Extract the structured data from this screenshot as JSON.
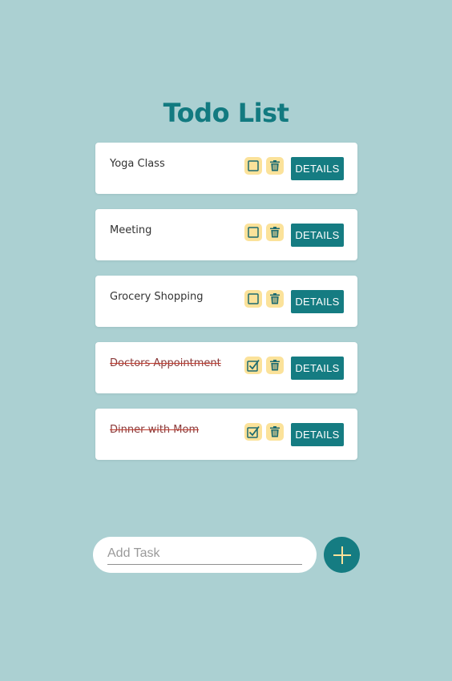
{
  "app": {
    "title": "Todo List"
  },
  "tasks": [
    {
      "label": "Yoga Class",
      "done": false,
      "details_label": "DETAILS"
    },
    {
      "label": "Meeting",
      "done": false,
      "details_label": "DETAILS"
    },
    {
      "label": "Grocery Shopping",
      "done": false,
      "details_label": "DETAILS"
    },
    {
      "label": "Doctors Appointment",
      "done": true,
      "details_label": "DETAILS"
    },
    {
      "label": "Dinner with Mom",
      "done": true,
      "details_label": "DETAILS"
    }
  ],
  "add_task": {
    "placeholder": "Add Task",
    "value": "",
    "button_icon": "plus-icon"
  },
  "icons": {
    "checkbox_unchecked": "checkbox-icon",
    "checkbox_checked": "checkbox-checked-icon",
    "delete": "trash-icon"
  },
  "colors": {
    "background": "#abd0d2",
    "accent": "#157c82",
    "title": "#127a80",
    "icon_button_bg": "#fbe29a",
    "done_strike": "#c0392b",
    "plus_icon": "#fbe29a"
  }
}
